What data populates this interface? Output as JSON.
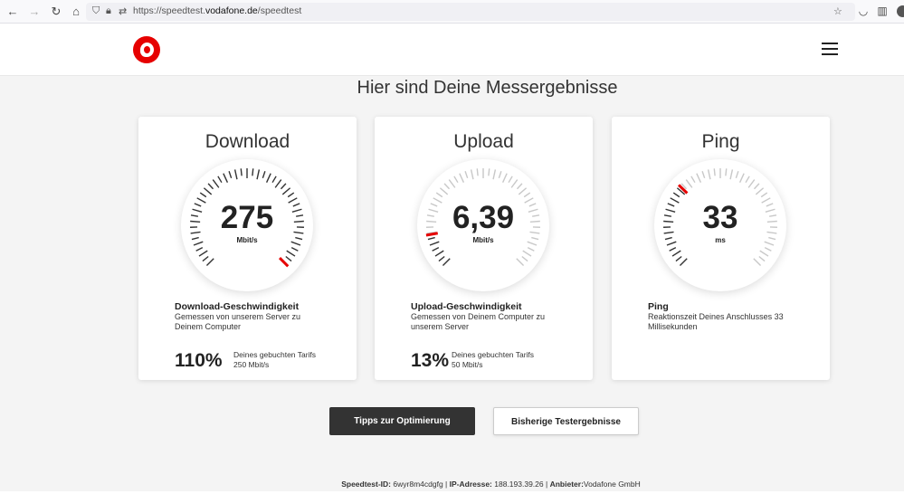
{
  "browser": {
    "url_prefix": "https://speedtest.",
    "url_domain": "vodafone.de",
    "url_path": "/speedtest"
  },
  "page": {
    "title": "Hier sind Deine Messergebnisse"
  },
  "cards": {
    "download": {
      "title": "Download",
      "value": "275",
      "unit": "Mbit/s",
      "fill_fraction": 1.0,
      "desc_title": "Download-Geschwindigkeit",
      "desc_text": "Gemessen von unserem Server zu Deinem Computer",
      "percent": "110%",
      "tariff_label": "Deines gebuchten Tarifs",
      "tariff_value": "250 Mbit/s"
    },
    "upload": {
      "title": "Upload",
      "value": "6,39",
      "unit": "Mbit/s",
      "fill_fraction": 0.13,
      "desc_title": "Upload-Geschwindigkeit",
      "desc_text": "Gemessen von Deinem Computer zu unserem Server",
      "percent": "13%",
      "tariff_label": "Deines gebuchten Tarifs",
      "tariff_value": "50 Mbit/s"
    },
    "ping": {
      "title": "Ping",
      "value": "33",
      "unit": "ms",
      "fill_fraction": 0.33,
      "desc_title": "Ping",
      "desc_text": "Reaktionszeit Deines Anschlusses 33 Millisekunden"
    }
  },
  "buttons": {
    "tips": "Tipps zur Optimierung",
    "history": "Bisherige Testergebnisse"
  },
  "footer": {
    "id_label": "Speedtest-ID:",
    "id_value": "6wyr8m4cdgfg",
    "ip_label": "IP-Adresse:",
    "ip_value": "188.193.39.26",
    "provider_label": "Anbieter:",
    "provider_value": "Vodafone GmbH",
    "separator": "|"
  },
  "colors": {
    "accent": "#e60000",
    "tick": "#333333",
    "tick_light": "#c8c8c8"
  }
}
